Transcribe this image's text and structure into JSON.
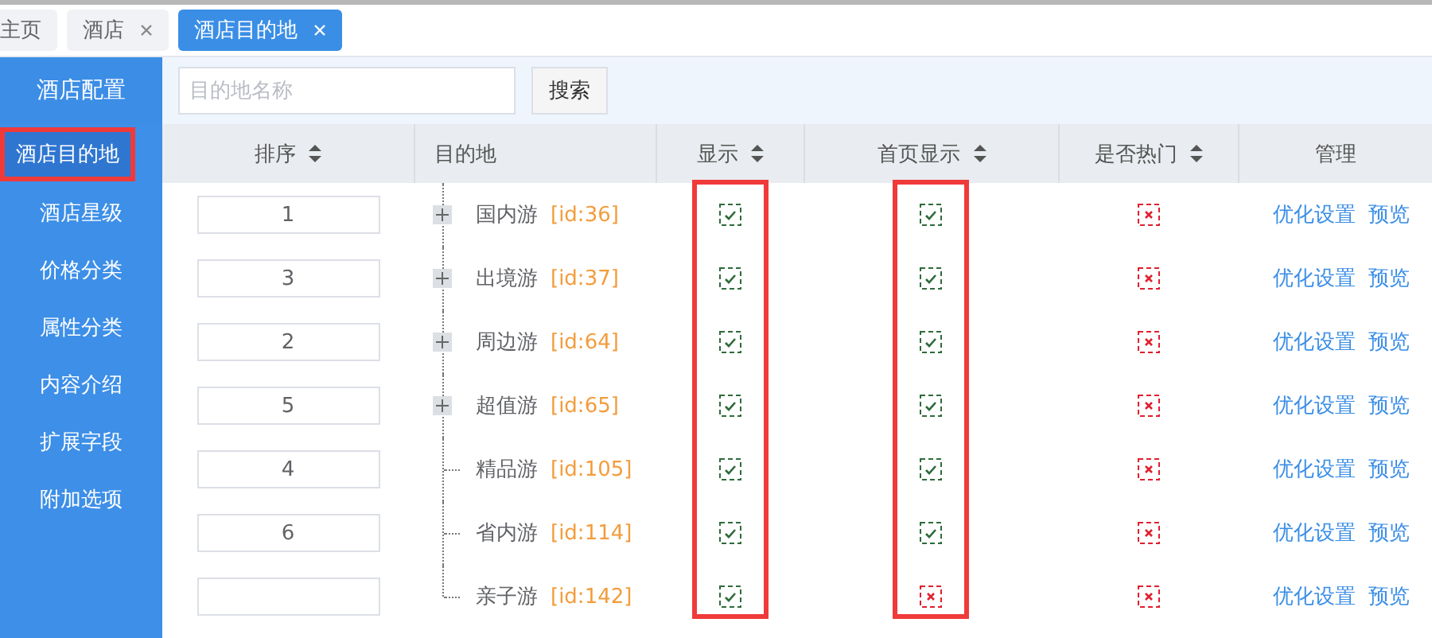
{
  "tabs": [
    {
      "label": "主页",
      "selected": false,
      "closable": false
    },
    {
      "label": "酒店",
      "selected": false,
      "closable": true
    },
    {
      "label": "酒店目的地",
      "selected": true,
      "closable": true
    }
  ],
  "sidebar": {
    "title": "酒店配置",
    "items": [
      {
        "label": "酒店目的地",
        "selected": true,
        "highlighted": true
      },
      {
        "label": "酒店星级",
        "selected": false,
        "highlighted": false
      },
      {
        "label": "价格分类",
        "selected": false,
        "highlighted": false
      },
      {
        "label": "属性分类",
        "selected": false,
        "highlighted": false
      },
      {
        "label": "内容介绍",
        "selected": false,
        "highlighted": false
      },
      {
        "label": "扩展字段",
        "selected": false,
        "highlighted": false
      },
      {
        "label": "附加选项",
        "selected": false,
        "highlighted": false
      }
    ]
  },
  "search": {
    "placeholder": "目的地名称",
    "button": "搜索"
  },
  "table": {
    "columns": [
      {
        "label": "排序",
        "sortable": true,
        "highlighted": false
      },
      {
        "label": "目的地",
        "sortable": false,
        "highlighted": false
      },
      {
        "label": "显示",
        "sortable": true,
        "highlighted": true
      },
      {
        "label": "首页显示",
        "sortable": true,
        "highlighted": true
      },
      {
        "label": "是否热门",
        "sortable": true,
        "highlighted": false
      },
      {
        "label": "管理",
        "sortable": false,
        "highlighted": false
      }
    ],
    "rows": [
      {
        "order": "1",
        "name": "国内游",
        "id": "[id:36]",
        "expandable": true,
        "shown": true,
        "home": true,
        "hot": false,
        "actions": [
          "优化设置",
          "预览"
        ]
      },
      {
        "order": "3",
        "name": "出境游",
        "id": "[id:37]",
        "expandable": true,
        "shown": true,
        "home": true,
        "hot": false,
        "actions": [
          "优化设置",
          "预览"
        ]
      },
      {
        "order": "2",
        "name": "周边游",
        "id": "[id:64]",
        "expandable": true,
        "shown": true,
        "home": true,
        "hot": false,
        "actions": [
          "优化设置",
          "预览"
        ]
      },
      {
        "order": "5",
        "name": "超值游",
        "id": "[id:65]",
        "expandable": true,
        "shown": true,
        "home": true,
        "hot": false,
        "actions": [
          "优化设置",
          "预览"
        ]
      },
      {
        "order": "4",
        "name": "精品游",
        "id": "[id:105]",
        "expandable": false,
        "shown": true,
        "home": true,
        "hot": false,
        "actions": [
          "优化设置",
          "预览"
        ]
      },
      {
        "order": "6",
        "name": "省内游",
        "id": "[id:114]",
        "expandable": false,
        "shown": true,
        "home": true,
        "hot": false,
        "actions": [
          "优化设置",
          "预览"
        ]
      },
      {
        "name": "亲子游",
        "id": "[id:142]",
        "expandable": false,
        "shown": true,
        "home": false,
        "hot": false,
        "actions": [
          "优化设置",
          "预览"
        ]
      }
    ]
  }
}
